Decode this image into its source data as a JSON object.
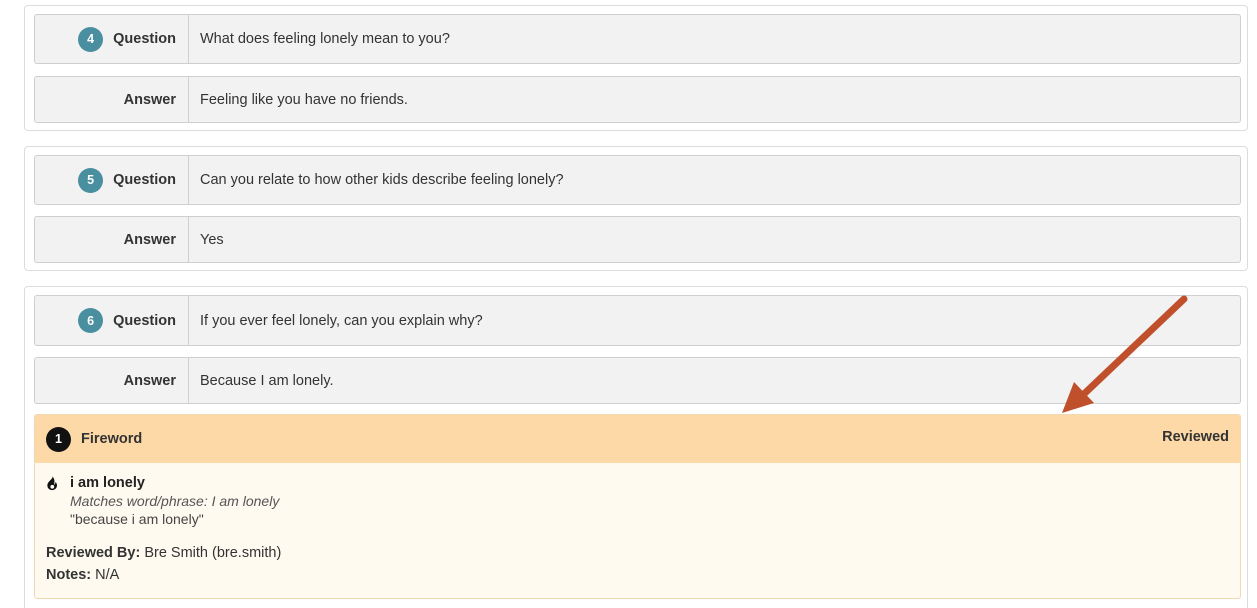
{
  "questions": [
    {
      "number": "4",
      "question_label": "Question",
      "question_text": "What does feeling lonely mean to you?",
      "answer_label": "Answer",
      "answer_text": "Feeling like you have no friends."
    },
    {
      "number": "5",
      "question_label": "Question",
      "question_text": "Can you relate to how other kids describe feeling lonely?",
      "answer_label": "Answer",
      "answer_text": "Yes"
    },
    {
      "number": "6",
      "question_label": "Question",
      "question_text": "If you ever feel lonely, can you explain why?",
      "answer_label": "Answer",
      "answer_text": "Because I am lonely."
    }
  ],
  "fireword": {
    "count": "1",
    "title": "Fireword",
    "status": "Reviewed",
    "match_word": "i am lonely",
    "match_line": "Matches word/phrase: I am lonely",
    "quote": "\"because i am lonely\"",
    "reviewed_by_label": "Reviewed By:",
    "reviewed_by_value": "Bre Smith (bre.smith)",
    "notes_label": "Notes:",
    "notes_value": "N/A",
    "icon": "flame-icon"
  },
  "colors": {
    "number_badge": "#4a8fa0",
    "fireword_header": "#fdd9a7",
    "fireword_body": "#fffaf0",
    "annotation_arrow": "#c0502b"
  }
}
